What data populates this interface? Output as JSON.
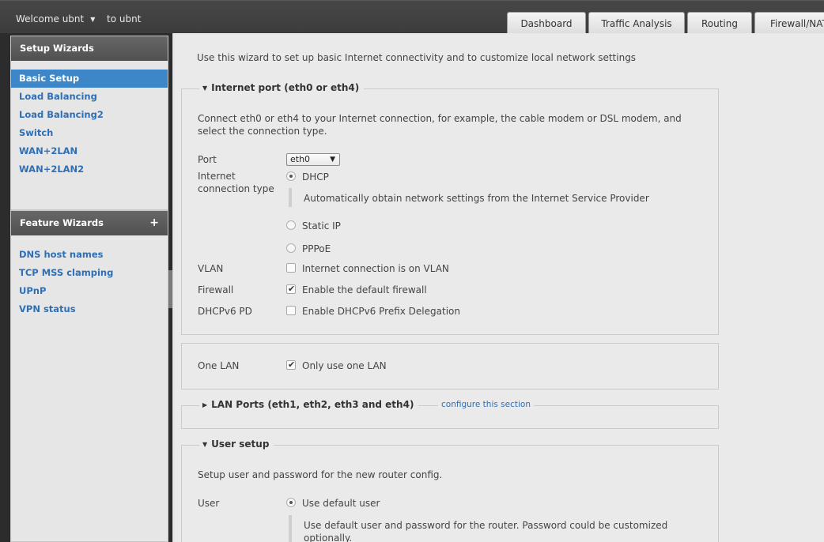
{
  "header": {
    "welcome": "Welcome ubnt",
    "logout_link": "to ubnt",
    "tabs": [
      "Dashboard",
      "Traffic Analysis",
      "Routing",
      "Firewall/NAT"
    ]
  },
  "sidebar": {
    "setup_title": "Setup Wizards",
    "setup_items": [
      "Basic Setup",
      "Load Balancing",
      "Load Balancing2",
      "Switch",
      "WAN+2LAN",
      "WAN+2LAN2"
    ],
    "active_item": "Basic Setup",
    "feature_title": "Feature Wizards",
    "feature_add": "+",
    "feature_items": [
      "DNS host names",
      "TCP MSS clamping",
      "UPnP",
      "VPN status"
    ]
  },
  "main": {
    "intro": "Use this wizard to set up basic Internet connectivity and to customize local network settings",
    "internet": {
      "legend": "Internet port (eth0 or eth4)",
      "text": "Connect eth0 or eth4 to your Internet connection, for example, the cable modem or DSL modem, and select the connection type.",
      "port_label": "Port",
      "port_value": "eth0",
      "conn_label": "Internet connection type",
      "dhcp": "DHCP",
      "dhcp_desc": "Automatically obtain network settings from the Internet Service Provider",
      "static": "Static IP",
      "pppoe": "PPPoE",
      "vlan_label": "VLAN",
      "vlan_text": "Internet connection is on VLAN",
      "firewall_label": "Firewall",
      "firewall_text": "Enable the default firewall",
      "dhcpv6_label": "DHCPv6 PD",
      "dhcpv6_text": "Enable DHCPv6 Prefix Delegation"
    },
    "one_lan": {
      "label": "One LAN",
      "text": "Only use one LAN"
    },
    "lan_ports": {
      "legend": "LAN Ports (eth1, eth2, eth3 and eth4)",
      "link": "configure this section"
    },
    "user_setup": {
      "legend": "User setup",
      "text": "Setup user and password for the new router config.",
      "user_label": "User",
      "default_user": "Use default user",
      "default_desc": "Use default user and password for the router. Password could be customized optionally."
    }
  },
  "colors": {
    "accent": "#3d87c8",
    "link": "#2f6fb5",
    "topbar": "#424242",
    "panel_bg": "#eaeaea"
  }
}
